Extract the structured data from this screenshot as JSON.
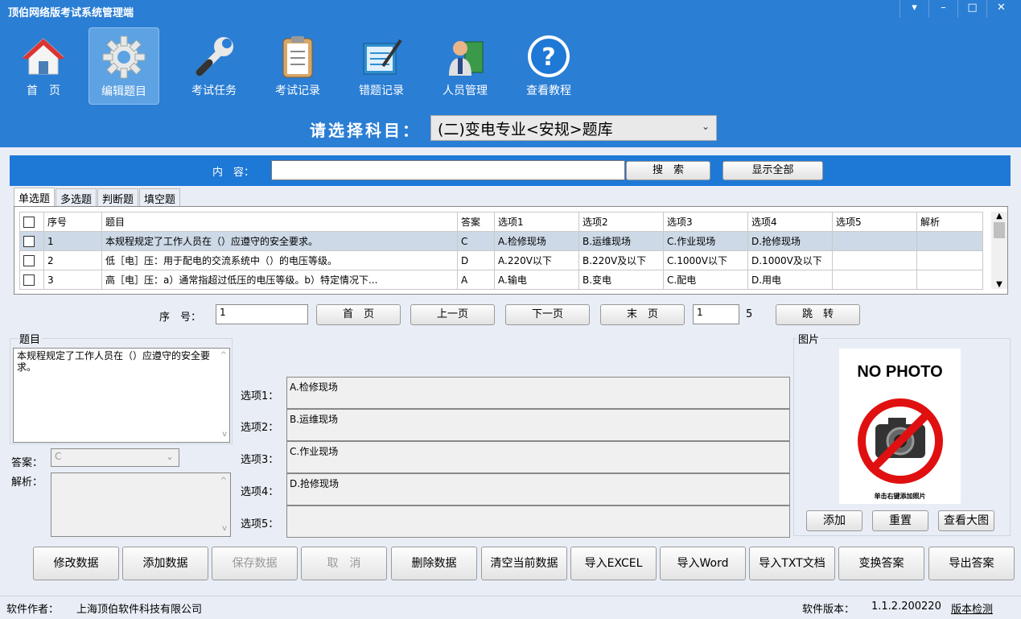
{
  "app": {
    "title": "顶伯网络版考试系统管理端"
  },
  "window_buttons": [
    "▾",
    "–",
    "□",
    "✕"
  ],
  "nav": [
    {
      "label": "首　页",
      "icon": "home-icon"
    },
    {
      "label": "编辑题目",
      "icon": "gear-icon",
      "active": true
    },
    {
      "label": "考试任务",
      "icon": "wrench-icon"
    },
    {
      "label": "考试记录",
      "icon": "clipboard-icon"
    },
    {
      "label": "错题记录",
      "icon": "notepad-icon"
    },
    {
      "label": "人员管理",
      "icon": "person-book-icon"
    },
    {
      "label": "查看教程",
      "icon": "help-icon"
    }
  ],
  "subject": {
    "label": "请选择科目：",
    "value": "(二)变电专业<安规>题库"
  },
  "search": {
    "label": "内　容：",
    "value": "",
    "search_button": "搜　索",
    "show_all_button": "显示全部"
  },
  "tabs": [
    "单选题",
    "多选题",
    "判断题",
    "填空题"
  ],
  "table": {
    "headers": [
      "",
      "序号",
      "题目",
      "答案",
      "选项1",
      "选项2",
      "选项3",
      "选项4",
      "选项5",
      "解析"
    ],
    "rows": [
      [
        "",
        "1",
        "本规程规定了工作人员在（）应遵守的安全要求。",
        "C",
        "A.检修现场",
        "B.运维现场",
        "C.作业现场",
        "D.抢修现场",
        "",
        ""
      ],
      [
        "",
        "2",
        "低［电］压：用于配电的交流系统中（）的电压等级。",
        "D",
        "A.220V以下",
        "B.220V及以下",
        "C.1000V以下",
        "D.1000V及以下",
        "",
        ""
      ],
      [
        "",
        "3",
        "高［电］压：a）通常指超过低压的电压等级。b）特定情况下...",
        "A",
        "A.输电",
        "B.变电",
        "C.配电",
        "D.用电",
        "",
        ""
      ]
    ]
  },
  "pager": {
    "label": "序　号：",
    "current": "1",
    "first": "首　页",
    "prev": "上一页",
    "next": "下一页",
    "last": "末　页",
    "jump_value": "1",
    "total": "5",
    "jump": "跳　转"
  },
  "detail": {
    "question_label": "题目",
    "question": "本规程规定了工作人员在（）应遵守的安全要求。",
    "answer_label": "答案：",
    "answer": "C",
    "analysis_label": "解析：",
    "analysis": "",
    "options": [
      {
        "label": "选项1：",
        "value": "A.检修现场"
      },
      {
        "label": "选项2：",
        "value": "B.运维现场"
      },
      {
        "label": "选项3：",
        "value": "C.作业现场"
      },
      {
        "label": "选项4：",
        "value": "D.抢修现场"
      },
      {
        "label": "选项5：",
        "value": ""
      }
    ],
    "image_label": "图片",
    "no_photo": "NO PHOTO",
    "no_photo_hint": "单击右键添加照片",
    "image_buttons": [
      "添加",
      "重置",
      "查看大图"
    ]
  },
  "bottom_buttons": [
    {
      "label": "修改数据",
      "enabled": true
    },
    {
      "label": "添加数据",
      "enabled": true
    },
    {
      "label": "保存数据",
      "enabled": false
    },
    {
      "label": "取　消",
      "enabled": false
    },
    {
      "label": "删除数据",
      "enabled": true
    },
    {
      "label": "清空当前数据",
      "enabled": true
    },
    {
      "label": "导入EXCEL",
      "enabled": true
    },
    {
      "label": "导入Word",
      "enabled": true
    },
    {
      "label": "导入TXT文档",
      "enabled": true
    },
    {
      "label": "变换答案",
      "enabled": true
    },
    {
      "label": "导出答案",
      "enabled": true
    }
  ],
  "status": {
    "author_label": "软件作者：",
    "author": "上海顶伯软件科技有限公司",
    "version_label": "软件版本：",
    "version": "1.1.2.200220",
    "check": "版本检测"
  }
}
